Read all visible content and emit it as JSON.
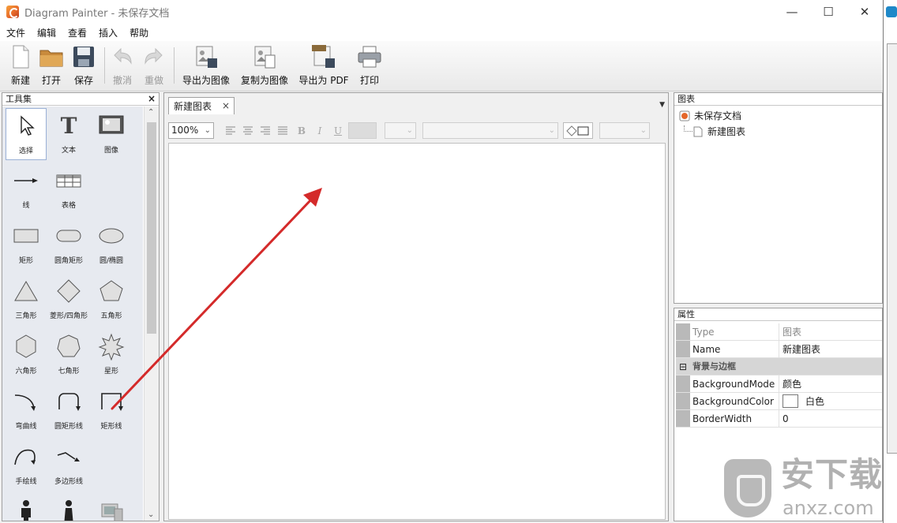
{
  "window": {
    "title": "Diagram Painter - 未保存文档",
    "minimize": "—",
    "maximize": "☐",
    "close": "✕"
  },
  "menu": [
    "文件",
    "编辑",
    "查看",
    "插入",
    "帮助"
  ],
  "toolbar": {
    "new": "新建",
    "open": "打开",
    "save": "保存",
    "undo": "撤消",
    "redo": "重做",
    "export_image": "导出为图像",
    "copy_image": "复制为图像",
    "export_pdf": "导出为 PDF",
    "print": "打印"
  },
  "toolbox": {
    "title": "工具集",
    "close": "×",
    "tools": [
      "选择",
      "文本",
      "图像",
      "线",
      "表格",
      "矩形",
      "圆角矩形",
      "圆/椭圆",
      "三角形",
      "菱形/四角形",
      "五角形",
      "六角形",
      "七角形",
      "星形",
      "弯曲线",
      "圆矩形线",
      "矩形线",
      "手绘线",
      "多边形线"
    ]
  },
  "document": {
    "tab_label": "新建图表",
    "tab_close": "×",
    "zoom": "100%",
    "tab_menu": "▼"
  },
  "format_bar": {
    "bold": "B",
    "italic": "I",
    "underline": "U"
  },
  "diagram_panel": {
    "title": "图表",
    "root": "未保存文档",
    "child": "新建图表"
  },
  "properties_panel": {
    "title": "属性",
    "rows": [
      {
        "key": "Type",
        "value": "图表"
      },
      {
        "key": "Name",
        "value": "新建图表"
      }
    ],
    "category": "背景与边框",
    "category_toggle": "⊟",
    "bg_rows": [
      {
        "key": "BackgroundMode",
        "value": "颜色"
      },
      {
        "key": "BackgroundColor",
        "value": "白色"
      },
      {
        "key": "BorderWidth",
        "value": "0"
      }
    ]
  },
  "watermark": {
    "big": "安下载",
    "small": "anxz.com"
  },
  "colors": {
    "annotation_arrow": "#d42a2a",
    "toolbox_bg": "#e7eaf0",
    "property_gutter": "#b9b9b9"
  }
}
